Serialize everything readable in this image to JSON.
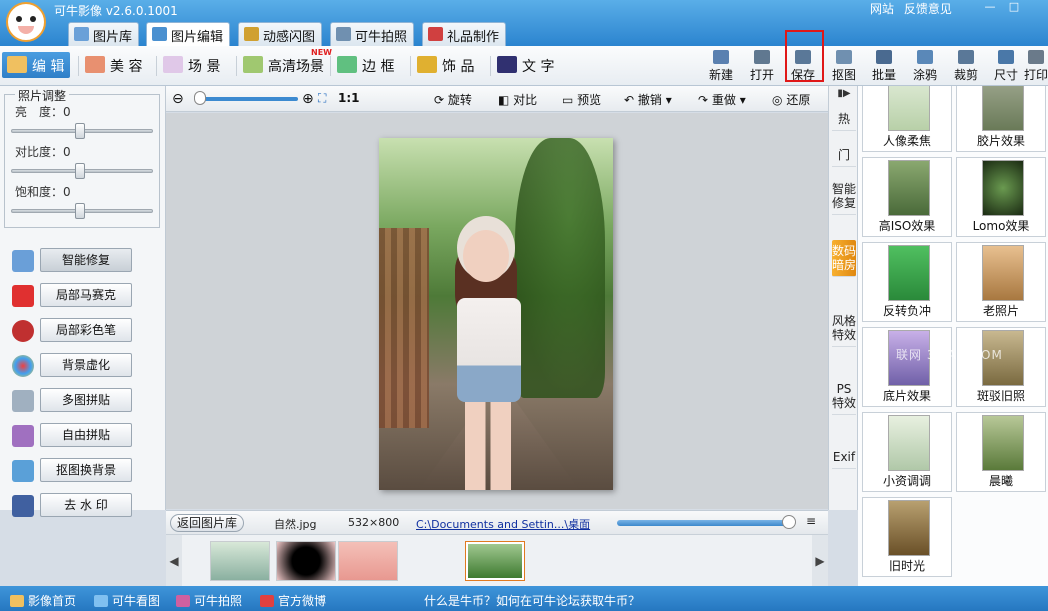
{
  "app": {
    "title": "可牛影像 v2.6.0.1001",
    "links": [
      "网站",
      "反馈意见"
    ],
    "window_controls": [
      "—",
      "□"
    ]
  },
  "main_tabs": [
    {
      "label": "图片库",
      "icon": "gallery-icon",
      "color": "#6aa0d8"
    },
    {
      "label": "图片编辑",
      "icon": "edit-image-icon",
      "color": "#4a90d0"
    },
    {
      "label": "动感闪图",
      "icon": "flash-image-icon",
      "color": "#d0a030"
    },
    {
      "label": "可牛拍照",
      "icon": "camera-icon",
      "color": "#7090b0"
    },
    {
      "label": "礼品制作",
      "icon": "gift-icon",
      "color": "#d04040"
    }
  ],
  "edit_tabs": [
    {
      "label": "编 辑",
      "icon": "edit-icon",
      "color": "#f0c060"
    },
    {
      "label": "美 容",
      "icon": "beauty-icon",
      "color": "#e89070"
    },
    {
      "label": "场 景",
      "icon": "scene-icon",
      "color": "#e0c8e8"
    },
    {
      "label": "高清场景",
      "icon": "hd-scene-icon",
      "color": "#a0c870",
      "badge": "NEW"
    },
    {
      "label": "边 框",
      "icon": "frame-icon",
      "color": "#60c080"
    },
    {
      "label": "饰 品",
      "icon": "accessory-icon",
      "color": "#e0b030"
    },
    {
      "label": "文 字",
      "icon": "text-icon",
      "color": "#303070"
    }
  ],
  "tools": [
    {
      "label": "新建",
      "icon": "new-file-icon"
    },
    {
      "label": "打开",
      "icon": "open-folder-icon"
    },
    {
      "label": "保存",
      "icon": "save-icon"
    },
    {
      "label": "抠图",
      "icon": "cutout-icon"
    },
    {
      "label": "批量",
      "icon": "batch-icon"
    },
    {
      "label": "涂鸦",
      "icon": "doodle-icon"
    },
    {
      "label": "裁剪",
      "icon": "crop-icon"
    },
    {
      "label": "尺寸",
      "icon": "resize-icon"
    },
    {
      "label": "打印",
      "icon": "print-icon"
    }
  ],
  "adjust": {
    "title": "照片调整",
    "sliders": [
      {
        "label": "亮　度：0",
        "value": 0
      },
      {
        "label": "对比度：0",
        "value": 0
      },
      {
        "label": "饱和度：0",
        "value": 0
      }
    ]
  },
  "features": [
    {
      "label": "智能修复",
      "icon": "smart-fix-icon",
      "color": "#6a9fd8",
      "active": true
    },
    {
      "label": "局部马赛克",
      "icon": "mosaic-icon",
      "color": "#e03030"
    },
    {
      "label": "局部彩色笔",
      "icon": "color-pen-icon",
      "color": "#c03030"
    },
    {
      "label": "背景虚化",
      "icon": "blur-icon",
      "color": "#e0a030"
    },
    {
      "label": "多图拼贴",
      "icon": "multi-collage-icon",
      "color": "#a0b0c0"
    },
    {
      "label": "自由拼贴",
      "icon": "free-collage-icon",
      "color": "#a070c0"
    },
    {
      "label": "抠图换背景",
      "icon": "replace-bg-icon",
      "color": "#5aa0d8"
    },
    {
      "label": "去 水 印",
      "icon": "remove-watermark-icon",
      "color": "#4060a0"
    }
  ],
  "canvas_bar": {
    "zoom_ratio": "1:1",
    "actions": [
      "旋转",
      "对比",
      "预览",
      "撤销",
      "重做",
      "还原"
    ]
  },
  "info_bar": {
    "back": "返回图片库",
    "filename": "自然.jpg",
    "dimensions": "532×800",
    "path": "C:\\Documents and Settin...\\桌面"
  },
  "thumbnails": [
    {
      "name": "thumb-wedding",
      "color": "#b0c8b0"
    },
    {
      "name": "thumb-black",
      "color": "#202020"
    },
    {
      "name": "thumb-pink",
      "color": "#e8a8a0"
    },
    {
      "name": "thumb-current",
      "color": "#3e7a30",
      "selected": true
    }
  ],
  "vtabs": [
    "热",
    "门",
    "智能修复",
    "数码暗房",
    "风格特效",
    "PS特效",
    "Exif"
  ],
  "effects": [
    {
      "label": "人像柔焦",
      "tint": "#b8d0a8"
    },
    {
      "label": "胶片效果",
      "tint": "#6a7a58"
    },
    {
      "label": "高ISO效果",
      "tint": "#4a6a3a"
    },
    {
      "label": "Lomo效果",
      "tint": "#2a4a22"
    },
    {
      "label": "反转负冲",
      "tint": "#2a8a3a"
    },
    {
      "label": "老照片",
      "tint": "#c89860"
    },
    {
      "label": "底片效果",
      "tint": "#9080c0"
    },
    {
      "label": "斑驳旧照",
      "tint": "#9a8a60"
    },
    {
      "label": "小资调调",
      "tint": "#c8d8c0"
    },
    {
      "label": "晨曦",
      "tint": "#7a9a5a"
    },
    {
      "label": "旧时光",
      "tint": "#8a7040"
    }
  ],
  "watermark": "联网 3LIAN.COM",
  "status": [
    {
      "label": "影像首页",
      "icon": "home-icon",
      "color": "#f0c060"
    },
    {
      "label": "可牛看图",
      "icon": "viewer-icon",
      "color": "#80c0f0"
    },
    {
      "label": "可牛拍照",
      "icon": "camera-icon",
      "color": "#d060a0"
    },
    {
      "label": "官方微博",
      "icon": "weibo-icon",
      "color": "#e04040"
    },
    {
      "label": "什么是牛币？如何在可牛论坛获取牛币？",
      "icon": "",
      "color": ""
    }
  ]
}
